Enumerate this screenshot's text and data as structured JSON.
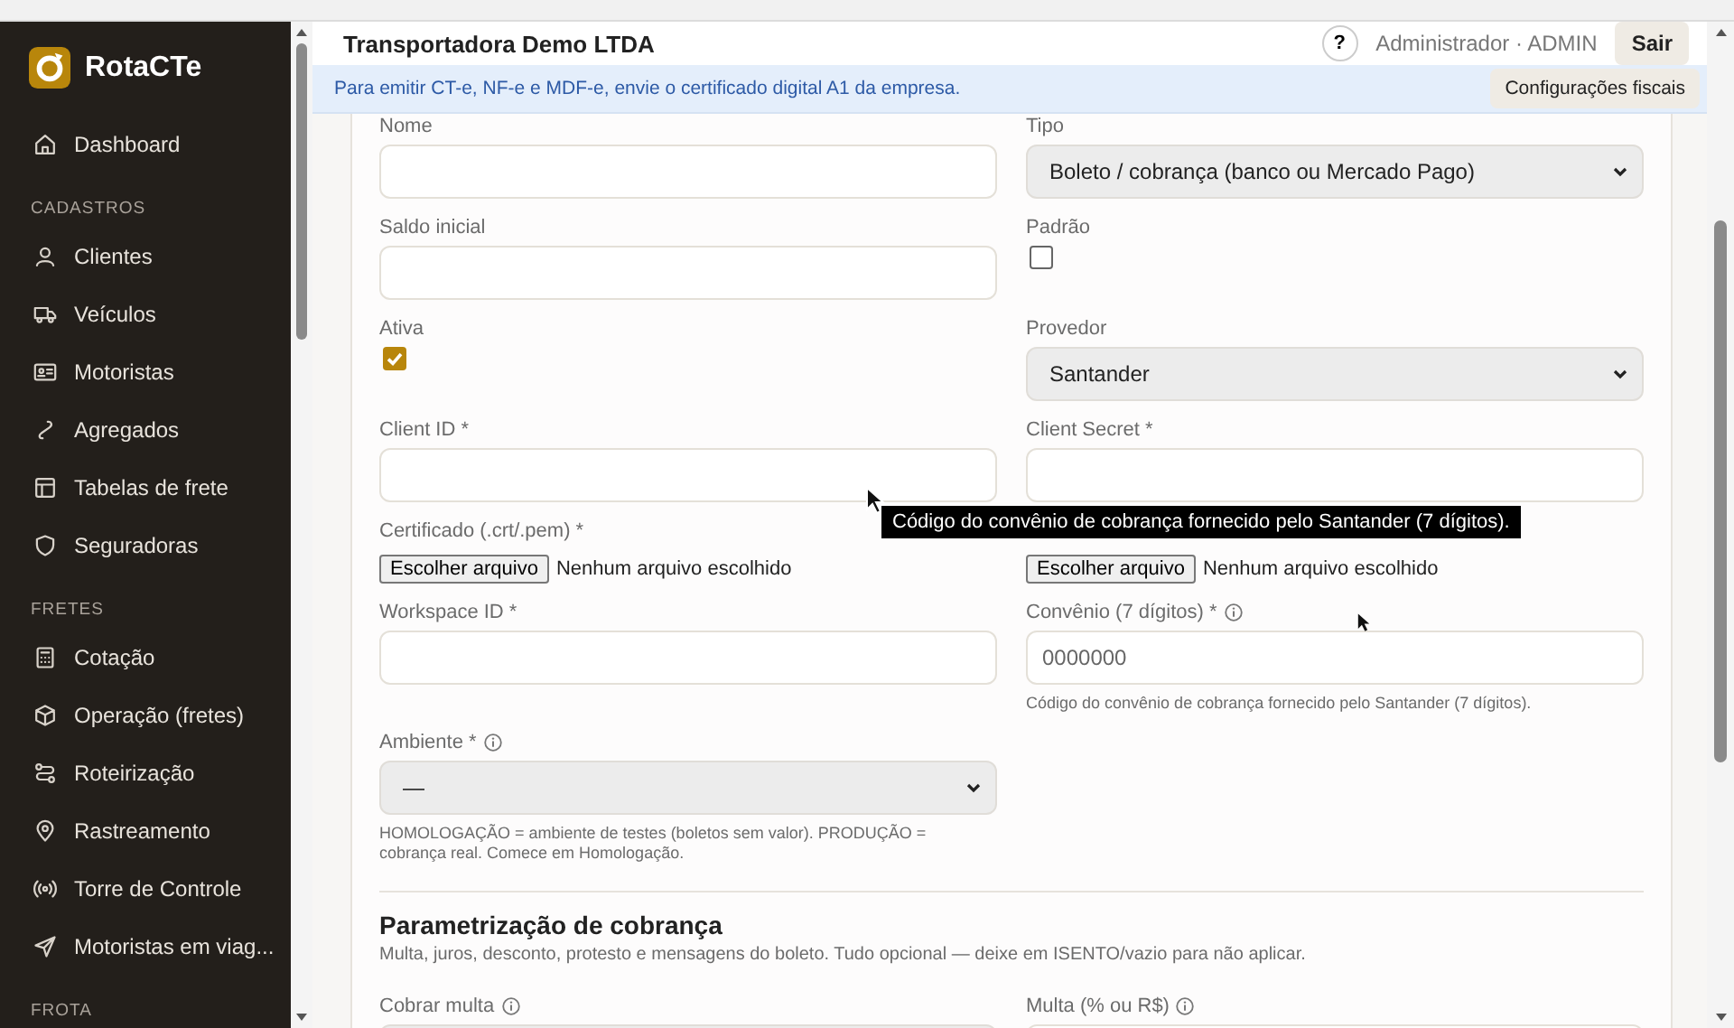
{
  "sidebar": {
    "brand": "RotaCTe",
    "items": [
      {
        "kind": "link",
        "label": "Dashboard"
      },
      {
        "kind": "section",
        "label": "CADASTROS"
      },
      {
        "kind": "link",
        "label": "Clientes"
      },
      {
        "kind": "link",
        "label": "Veículos"
      },
      {
        "kind": "link",
        "label": "Motoristas"
      },
      {
        "kind": "link",
        "label": "Agregados"
      },
      {
        "kind": "link",
        "label": "Tabelas de frete"
      },
      {
        "kind": "link",
        "label": "Seguradoras"
      },
      {
        "kind": "section",
        "label": "FRETES"
      },
      {
        "kind": "link",
        "label": "Cotação"
      },
      {
        "kind": "link",
        "label": "Operação (fretes)"
      },
      {
        "kind": "link",
        "label": "Roteirização"
      },
      {
        "kind": "link",
        "label": "Rastreamento"
      },
      {
        "kind": "link",
        "label": "Torre de Controle"
      },
      {
        "kind": "link",
        "label": "Motoristas em viag..."
      },
      {
        "kind": "section",
        "label": "FROTA"
      }
    ]
  },
  "header": {
    "title": "Transportadora Demo LTDA",
    "help": "?",
    "user": "Administrador · ADMIN",
    "logout": "Sair"
  },
  "banner": {
    "text": "Para emitir CT-e, NF-e e MDF-e, envie o certificado digital A1 da empresa.",
    "button": "Configurações fiscais"
  },
  "form": {
    "rows": [
      {
        "cells": [
          {
            "kind": "text",
            "label": "Nome"
          },
          {
            "kind": "select",
            "label": "Tipo",
            "value": "Boleto / cobrança (banco ou Mercado Pago)"
          }
        ]
      },
      {
        "cells": [
          {
            "kind": "text",
            "label": "Saldo inicial"
          },
          {
            "kind": "checkbox",
            "label": "Padrão",
            "checked": false
          }
        ]
      },
      {
        "cells": [
          {
            "kind": "checkbox",
            "label": "Ativa",
            "checked": true
          },
          {
            "kind": "select",
            "label": "Provedor",
            "value": "Santander"
          }
        ]
      },
      {
        "cells": [
          {
            "kind": "text",
            "label": "Client ID *"
          },
          {
            "kind": "text",
            "label": "Client Secret *"
          }
        ]
      },
      {
        "cells": [
          {
            "kind": "file",
            "label": "Certificado (.crt/.pem) *",
            "button": "Escolher arquivo",
            "status": "Nenhum arquivo escolhido"
          },
          {
            "kind": "file",
            "button": "Escolher arquivo",
            "status": "Nenhum arquivo escolhido"
          }
        ]
      },
      {
        "cells": [
          {
            "kind": "text",
            "label": "Workspace ID *"
          },
          {
            "kind": "text",
            "label": "Convênio (7 dígitos) *",
            "info": true,
            "placeholder": "0000000",
            "hint": "Código do convênio de cobrança fornecido pelo Santander (7 dígitos)."
          }
        ]
      },
      {
        "cells": [
          {
            "kind": "select",
            "label": "Ambiente *",
            "info": true,
            "value": "—",
            "hint": "HOMOLOGAÇÃO = ambiente de testes (boletos sem valor). PRODUÇÃO = cobrança real. Comece em Homologação."
          }
        ]
      }
    ],
    "section": {
      "title": "Parametrização de cobrança",
      "description": "Multa, juros, desconto, protesto e mensagens do boleto. Tudo opcional — deixe em ISENTO/vazio para não aplicar."
    },
    "section_rows": [
      {
        "cells": [
          {
            "kind": "select",
            "label": "Cobrar multa",
            "info": true
          },
          {
            "kind": "text",
            "label": "Multa (% ou R$)",
            "info": true
          }
        ]
      }
    ]
  },
  "tooltip": {
    "text": "Código do convênio de cobrança fornecido pelo Santander (7 dígitos)."
  }
}
